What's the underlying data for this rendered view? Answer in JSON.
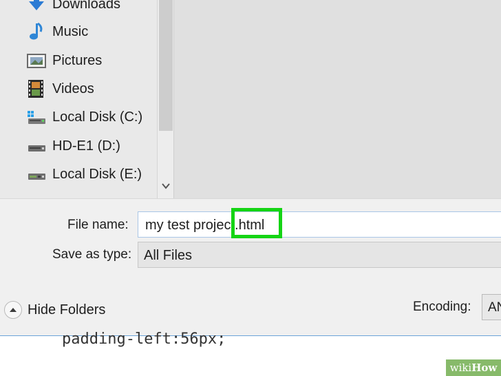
{
  "sidebar": {
    "items": [
      {
        "label": "Downloads",
        "icon": "download-arrow-icon"
      },
      {
        "label": "Music",
        "icon": "music-note-icon"
      },
      {
        "label": "Pictures",
        "icon": "picture-icon"
      },
      {
        "label": "Videos",
        "icon": "film-icon"
      },
      {
        "label": "Local Disk (C:)",
        "icon": "windows-drive-icon"
      },
      {
        "label": "HD-E1 (D:)",
        "icon": "drive-icon"
      },
      {
        "label": "Local Disk (E:)",
        "icon": "drive-icon"
      }
    ]
  },
  "form": {
    "file_name_label": "File name:",
    "file_name_value": "my test project.html",
    "save_as_type_label": "Save as type:",
    "save_as_type_value": "All Files",
    "hide_folders_label": "Hide Folders",
    "encoding_label": "Encoding:",
    "encoding_value": "AN"
  },
  "editor": {
    "code_line": "padding-left:56px;"
  },
  "watermark": {
    "prefix": "wiki",
    "suffix": "How"
  },
  "colors": {
    "highlight": "#14d414",
    "accent_border": "#6aa2d8"
  }
}
